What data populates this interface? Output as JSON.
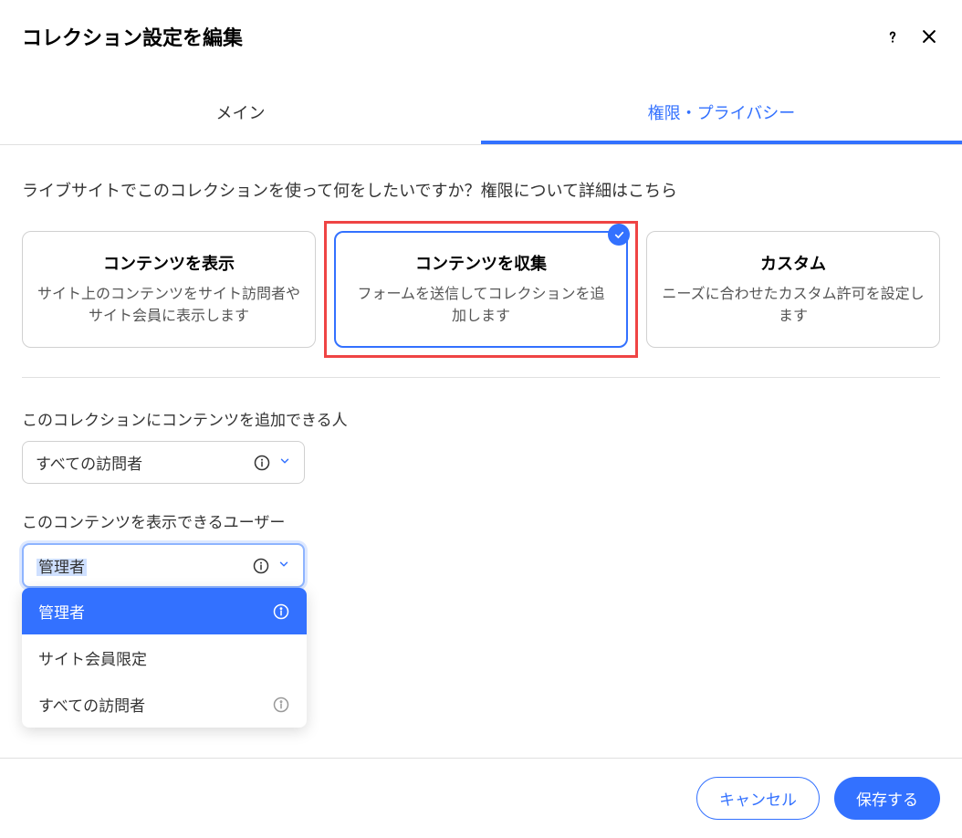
{
  "header": {
    "title": "コレクション設定を編集"
  },
  "tabs": {
    "main": "メイン",
    "privacy": "権限・プライバシー"
  },
  "question_part1": "ライブサイトでこのコレクションを使って何をしたいですか？",
  "question_link": "権限について詳細はこちら",
  "cards": {
    "show": {
      "title": "コンテンツを表示",
      "desc": "サイト上のコンテンツをサイト訪問者やサイト会員に表示します"
    },
    "collect": {
      "title": "コンテンツを収集",
      "desc": "フォームを送信してコレクションを追加します"
    },
    "custom": {
      "title": "カスタム",
      "desc": "ニーズに合わせたカスタム許可を設定します"
    }
  },
  "field1": {
    "label": "このコレクションにコンテンツを追加できる人",
    "value": "すべての訪問者"
  },
  "field2": {
    "label": "このコンテンツを表示できるユーザー",
    "value": "管理者"
  },
  "dropdown": {
    "opt1": "管理者",
    "opt2": "サイト会員限定",
    "opt3": "すべての訪問者"
  },
  "footer": {
    "cancel": "キャンセル",
    "save": "保存する"
  }
}
